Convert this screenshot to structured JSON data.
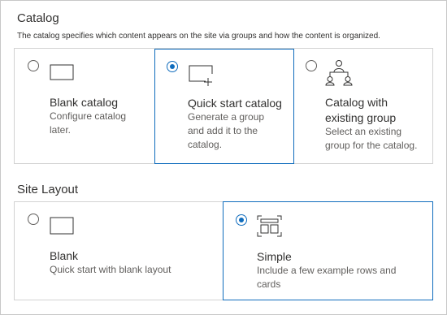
{
  "catalog": {
    "heading": "Catalog",
    "description": "The catalog specifies which content appears on the site via groups and how the content is organized.",
    "options": [
      {
        "title": "Blank catalog",
        "description": "Configure catalog later.",
        "selected": false,
        "icon": "blank-rectangle-icon"
      },
      {
        "title": "Quick start catalog",
        "description": "Generate a group and add it to the catalog.",
        "selected": true,
        "icon": "rectangle-plus-icon"
      },
      {
        "title": "Catalog with existing group",
        "description": "Select an existing group for the catalog.",
        "selected": false,
        "icon": "people-group-icon"
      }
    ]
  },
  "site_layout": {
    "heading": "Site Layout",
    "options": [
      {
        "title": "Blank",
        "description": "Quick start with blank layout",
        "selected": false,
        "icon": "blank-rectangle-icon"
      },
      {
        "title": "Simple",
        "description": "Include a few example rows and cards",
        "selected": true,
        "icon": "layout-grid-icon"
      }
    ]
  },
  "colors": {
    "accent": "#0f6cbd",
    "border": "#d2d2d2",
    "text": "#323130",
    "secondary_text": "#605e5c"
  }
}
